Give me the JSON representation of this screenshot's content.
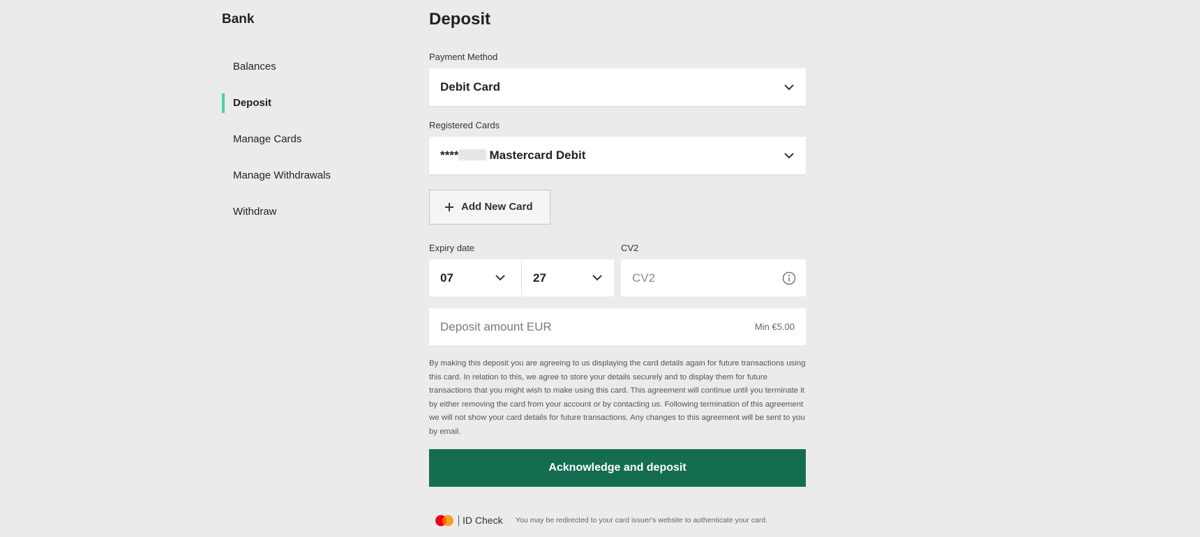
{
  "sidebar": {
    "title": "Bank",
    "items": [
      {
        "label": "Balances",
        "active": false
      },
      {
        "label": "Deposit",
        "active": true
      },
      {
        "label": "Manage Cards",
        "active": false
      },
      {
        "label": "Manage Withdrawals",
        "active": false
      },
      {
        "label": "Withdraw",
        "active": false
      }
    ],
    "active_indicator_color": "#4dd0a1"
  },
  "main": {
    "title": "Deposit",
    "payment_method": {
      "label": "Payment Method",
      "value": "Debit Card"
    },
    "registered_cards": {
      "label": "Registered Cards",
      "value_prefix": "****",
      "value_suffix": "Mastercard Debit"
    },
    "add_card_button": {
      "label": "Add New Card"
    },
    "expiry": {
      "label": "Expiry date",
      "month": "07",
      "year": "27"
    },
    "cv2": {
      "label": "CV2",
      "placeholder": "CV2"
    },
    "amount": {
      "placeholder": "Deposit amount EUR",
      "min_hint": "Min €5.00"
    },
    "terms": "By making this deposit you are agreeing to us displaying the card details again for future transactions using this card. In relation to this, we agree to store your details securely and to display them for future transactions that you might wish to make using this card. This agreement will continue until you terminate it by either removing the card from your account or by contacting us. Following termination of this agreement we will not show your card details for future transactions. Any changes to this agreement will be sent to you by email.",
    "submit_button": {
      "label": "Acknowledge and deposit",
      "color": "#146d51"
    },
    "id_check": {
      "brand_label": "ID Check",
      "note": "You may be redirected to your card issuer's website to authenticate your card."
    }
  }
}
